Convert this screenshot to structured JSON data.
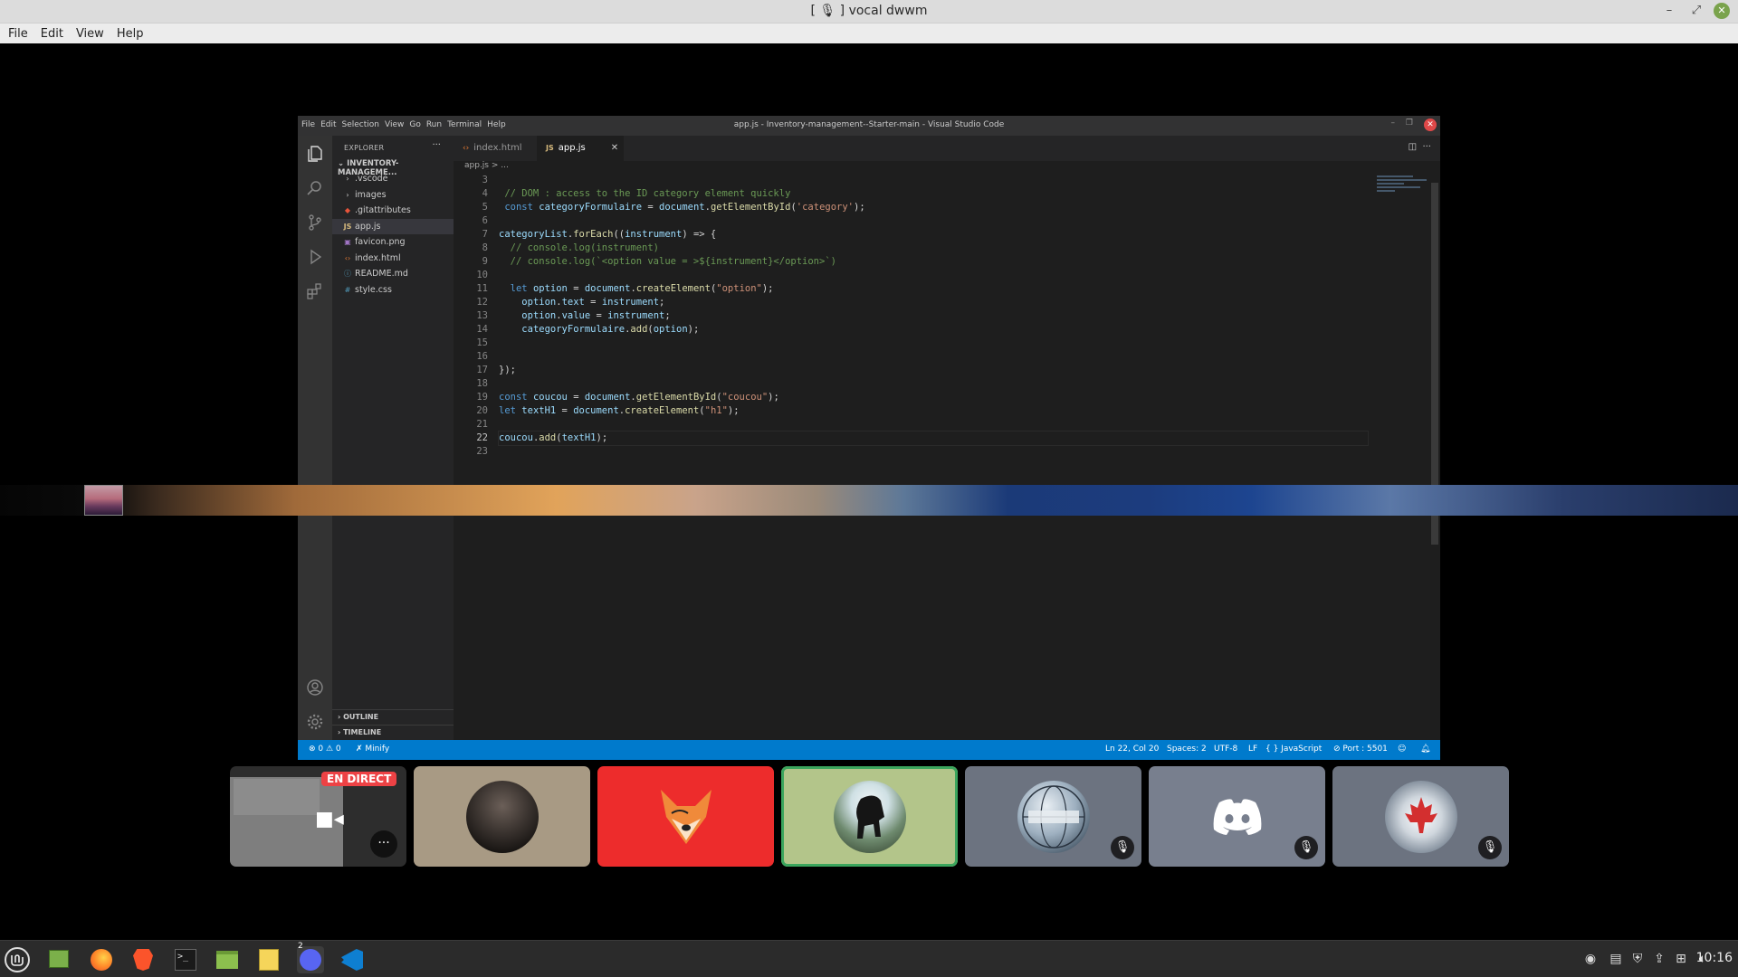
{
  "window": {
    "title": "[ 🎙 ] vocal dwwm",
    "menu": [
      "File",
      "Edit",
      "View",
      "Help"
    ]
  },
  "vscode": {
    "menu": [
      "File",
      "Edit",
      "Selection",
      "View",
      "Go",
      "Run",
      "Terminal",
      "Help"
    ],
    "title": "app.js - Inventory-management--Starter-main - Visual Studio Code",
    "explorer": {
      "header": "EXPLORER",
      "root": "INVENTORY-MANAGEME...",
      "items": [
        {
          "label": ".vscode",
          "icon": "folder-chevron-icon"
        },
        {
          "label": "images",
          "icon": "folder-chevron-icon"
        },
        {
          "label": ".gitattributes",
          "icon": "git-icon"
        },
        {
          "label": "app.js",
          "icon": "js-file-icon"
        },
        {
          "label": "favicon.png",
          "icon": "image-file-icon"
        },
        {
          "label": "index.html",
          "icon": "html-file-icon"
        },
        {
          "label": "README.md",
          "icon": "info-file-icon"
        },
        {
          "label": "style.css",
          "icon": "css-file-icon"
        }
      ],
      "outline": "OUTLINE",
      "timeline": "TIMELINE"
    },
    "tabs": [
      {
        "label": "index.html"
      },
      {
        "label": "app.js",
        "close": "✕"
      }
    ],
    "breadcrumb": "app.js > ...",
    "code": {
      "line_numbers": [
        "3",
        "4",
        "5",
        "6",
        "7",
        "8",
        "9",
        "10",
        "11",
        "12",
        "13",
        "14",
        "15",
        "16",
        "17",
        "18",
        "19",
        "20",
        "21",
        "22",
        "23"
      ],
      "lines": [
        "",
        " // DOM : access to the ID category element quickly",
        " const categoryFormulaire = document.getElementById('category');",
        "",
        "categoryList.forEach((instrument) => {",
        "  // console.log(instrument)",
        "  // console.log(`<option value = >${instrument}</option>`)",
        "",
        "  let option = document.createElement(\"option\");",
        "    option.text = instrument;",
        "    option.value = instrument;",
        "    categoryFormulaire.add(option);",
        "",
        "",
        "});",
        "",
        "const coucou = document.getElementById(\"coucou\");",
        "let textH1 = document.createElement(\"h1\");",
        "",
        "coucou.add(textH1);",
        ""
      ]
    },
    "status": {
      "problems": "⊗ 0 ⚠ 0",
      "minify": "✗ Minify",
      "position": "Ln 22, Col 20",
      "spaces": "Spaces: 2",
      "encoding": "UTF-8",
      "eol": "LF",
      "language": "{ } JavaScript",
      "port": "⊘ Port : 5501"
    },
    "colors": {
      "accent": "#007acc",
      "comment": "#6a9955",
      "keyword": "#569cd6",
      "string": "#ce9178",
      "func": "#dcdcaa",
      "var": "#9cdcfe"
    }
  },
  "call": {
    "live_badge": "EN DIRECT",
    "tiles": [
      {
        "bg": "#7a7a7a",
        "stream": true
      },
      {
        "bg": "#a89a84",
        "muted": false
      },
      {
        "bg": "#ed2c2c",
        "muted": false
      },
      {
        "bg": "#b3c58a",
        "muted": false,
        "speaking": true
      },
      {
        "bg": "#6c7380",
        "muted": true
      },
      {
        "bg": "#787f8e",
        "muted": true
      },
      {
        "bg": "#6c7380",
        "muted": true
      }
    ]
  },
  "taskbar": {
    "discord_badge": "2",
    "clock": "10:16"
  }
}
